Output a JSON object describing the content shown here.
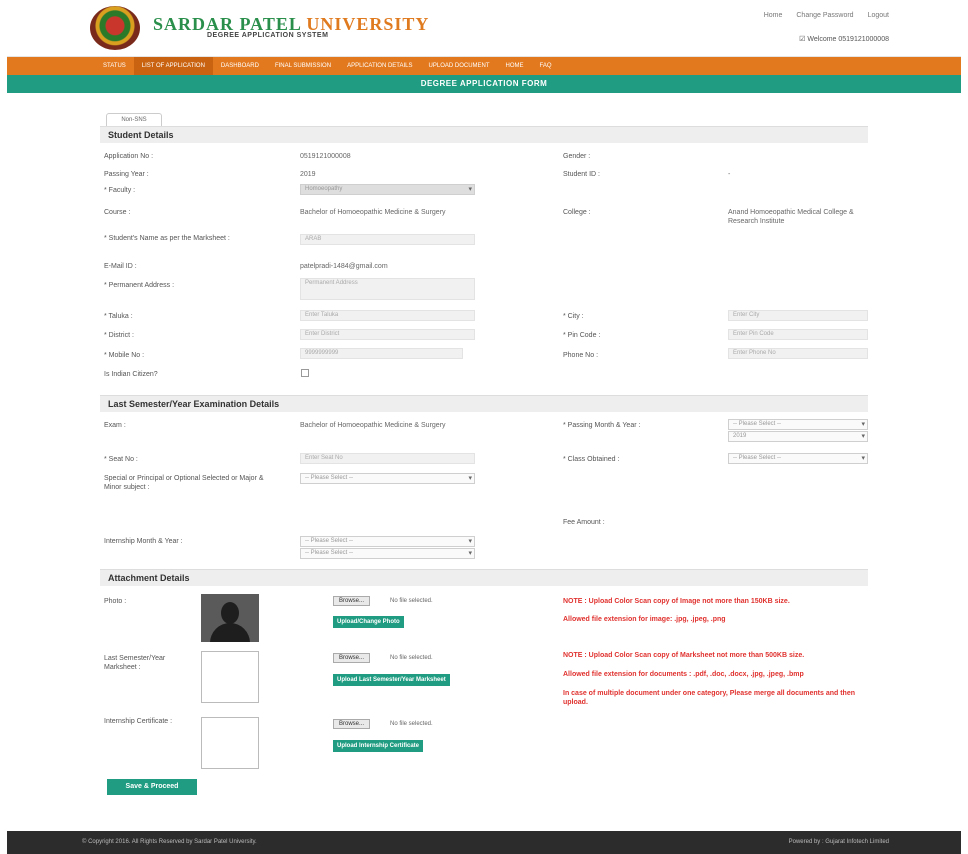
{
  "header": {
    "university_part1": "SARDAR PATEL",
    "university_part2": "UNIVERSITY",
    "system_name": "DEGREE APPLICATION SYSTEM",
    "links": {
      "home": "Home",
      "change_password": "Change Password",
      "logout": "Logout"
    },
    "welcome": "Welcome 0519121000008"
  },
  "nav": {
    "items": [
      "Status",
      "List of Application",
      "Dashboard",
      "Final Submission",
      "Application Details",
      "Upload Document",
      "Home",
      "FAQ"
    ]
  },
  "form": {
    "title": "DEGREE APPLICATION FORM",
    "tab_label": "Non-SNS"
  },
  "student": {
    "section_title": "Student Details",
    "application_no_label": "Application No :",
    "application_no": "0519121000008",
    "passing_year_label": "Passing Year :",
    "passing_year": "2019",
    "faculty_label": "* Faculty :",
    "faculty_value": "Homoeopathy",
    "course_label": "Course :",
    "course": "Bachelor of Homoeopathic Medicine & Surgery",
    "student_name_label": "* Student's Name as per the Marksheet :",
    "student_name_value": "ARAB",
    "email_label": "E-Mail ID :",
    "email": "patelpradi-1484@gmail.com",
    "address_label": "* Permanent Address :",
    "address_placeholder": "Permanent Address",
    "taluka_label": "* Taluka :",
    "taluka_placeholder": "Enter Taluka",
    "district_label": "* District :",
    "district_placeholder": "Enter District",
    "mobile_label": "* Mobile No :",
    "mobile_value": "9999999999",
    "indian_label": "Is Indian Citizen?",
    "gender_label": "Gender :",
    "student_id_label": "Student ID :",
    "student_id": "-",
    "college_label": "College :",
    "college": "Anand Homoeopathic Medical College & Research Institute",
    "city_label": "* City :",
    "city_placeholder": "Enter City",
    "pin_label": "* Pin Code :",
    "pin_placeholder": "Enter Pin Code",
    "phone_label": "Phone No :",
    "phone_placeholder": "Enter Phone No"
  },
  "exam": {
    "section_title": "Last Semester/Year Examination Details",
    "exam_label": "Exam :",
    "exam_value": "Bachelor of Homoeopathic Medicine & Surgery",
    "seat_label": "* Seat No :",
    "seat_placeholder": "Enter Seat No",
    "subject_label": "Special or Principal or Optional Selected or Major & Minor subject :",
    "subject_select": "-- Please Select --",
    "internship_label": "Internship Month & Year :",
    "internship_month": "-- Please Select --",
    "internship_year": "-- Please Select --",
    "passing_month_label": "* Passing Month & Year :",
    "passing_month": "-- Please Select --",
    "passing_year": "2019",
    "class_label": "* Class Obtained :",
    "class_select": "-- Please Select --",
    "fee_label": "Fee Amount :"
  },
  "attach": {
    "section_title": "Attachment Details",
    "photo_label": "Photo :",
    "marksheet_label": "Last Semester/Year Marksheet :",
    "internship_label": "Internship Certificate :",
    "browse": "Browse...",
    "no_file": "No file selected.",
    "upload_photo": "Upload/Change Photo",
    "upload_marksheet": "Upload Last Semester/Year Marksheet",
    "upload_internship": "Upload Internship Certificate",
    "note_photo_1": "NOTE : Upload Color Scan copy of Image not more than 150KB size.",
    "note_photo_2": "Allowed file extension for image: .jpg, .jpeg, .png",
    "note_marksheet_1": "NOTE : Upload Color Scan copy of Marksheet not more than 500KB size.",
    "note_marksheet_2": "Allowed file extension for documents : .pdf, .doc, .docx, .jpg, .jpeg, .bmp",
    "note_marksheet_3": "In case of multiple document under one category, Please merge all documents and then upload."
  },
  "actions": {
    "save": "Save & Proceed"
  },
  "footer": {
    "copyright": "© Copyright 2016. All Rights Reserved by Sardar Patel University.",
    "powered": "Powered by : Gujarat Infotech Limited"
  },
  "colors": {
    "brand_green": "#1f9c81",
    "nav_orange": "#e2791f",
    "note_red": "#e0322f"
  }
}
